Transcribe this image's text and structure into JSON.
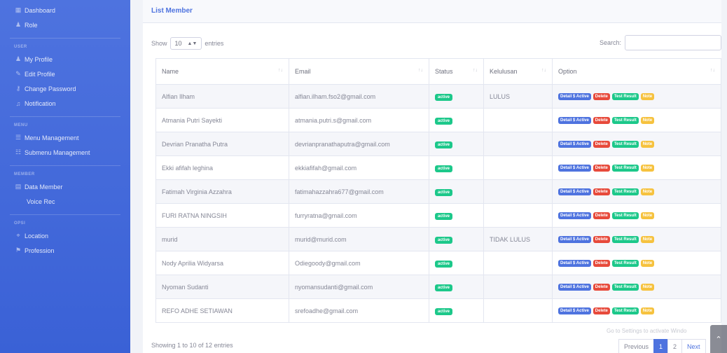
{
  "sidebar": {
    "top_items": [
      {
        "icon": "dashboard-icon",
        "glyph": "▦",
        "label": "Dashboard"
      },
      {
        "icon": "user-icon",
        "glyph": "♟",
        "label": "Role"
      }
    ],
    "section_user": "USER",
    "user_items": [
      {
        "icon": "user-icon",
        "glyph": "♟",
        "label": "My Profile"
      },
      {
        "icon": "user-edit-icon",
        "glyph": "✎",
        "label": "Edit Profile"
      },
      {
        "icon": "key-icon",
        "glyph": "⚷",
        "label": "Change Password"
      },
      {
        "icon": "bell-icon",
        "glyph": "♫",
        "label": "Notification"
      }
    ],
    "section_menu": "MENU",
    "menu_items": [
      {
        "icon": "menu-icon",
        "glyph": "☰",
        "label": "Menu Management"
      },
      {
        "icon": "submenu-icon",
        "glyph": "☷",
        "label": "Submenu Management"
      }
    ],
    "section_member": "MEMBER",
    "member_items": [
      {
        "icon": "data-member-icon",
        "glyph": "▤",
        "label": "Data Member"
      }
    ],
    "sub_item": "Voice Rec",
    "section_opsi": "OPSI",
    "opsi_items": [
      {
        "icon": "location-icon",
        "glyph": "⌖",
        "label": "Location"
      },
      {
        "icon": "profession-icon",
        "glyph": "⚑",
        "label": "Profession"
      }
    ]
  },
  "card": {
    "title": "List Member",
    "show_label": "Show",
    "entries_value": "10",
    "entries_label": "entries",
    "search_label": "Search:",
    "search_placeholder": ""
  },
  "table": {
    "headers": [
      "Name",
      "Email",
      "Status",
      "Kelulusan",
      "Option"
    ],
    "buttons": {
      "detail": "Detail $ Active",
      "delete": "Delete",
      "test": "Test Result",
      "note": "Note"
    },
    "rows": [
      {
        "name": "Alfian Ilham",
        "email": "alfian.ilham.fso2@gmail.com",
        "status": "active",
        "kelulusan": "LULUS"
      },
      {
        "name": "Atmania Putri Sayekti",
        "email": "atmania.putri.s@gmail.com",
        "status": "active",
        "kelulusan": ""
      },
      {
        "name": "Devrian Pranatha Putra",
        "email": "devrianpranathaputra@gmail.com",
        "status": "active",
        "kelulusan": ""
      },
      {
        "name": "Ekki afifah leghina",
        "email": "ekkiafifah@gmail.com",
        "status": "active",
        "kelulusan": ""
      },
      {
        "name": "Fatimah Virginia Azzahra",
        "email": "fatimahazzahra677@gmail.com",
        "status": "active",
        "kelulusan": ""
      },
      {
        "name": "FURI RATNA NINGSIH",
        "email": "furryratna@gmail.com",
        "status": "active",
        "kelulusan": ""
      },
      {
        "name": "murid",
        "email": "murid@murid.com",
        "status": "active",
        "kelulusan": "TIDAK LULUS"
      },
      {
        "name": "Nody Aprilia Widyarsa",
        "email": "Odiegoody@gmail.com",
        "status": "active",
        "kelulusan": ""
      },
      {
        "name": "Nyoman Sudanti",
        "email": "nyomansudanti@gmail.com",
        "status": "active",
        "kelulusan": ""
      },
      {
        "name": "REFO ADHE SETIAWAN",
        "email": "srefoadhe@gmail.com",
        "status": "active",
        "kelulusan": ""
      }
    ]
  },
  "footer": {
    "info": "Showing 1 to 10 of 12 entries",
    "watermark": "Go to Settings to activate Windo",
    "pagination": {
      "previous": "Previous",
      "pages": [
        "1",
        "2"
      ],
      "next": "Next"
    }
  },
  "colors": {
    "primary": "#4e73df",
    "success": "#1cc88a",
    "danger": "#e74a3b",
    "warning": "#f6c23e"
  }
}
